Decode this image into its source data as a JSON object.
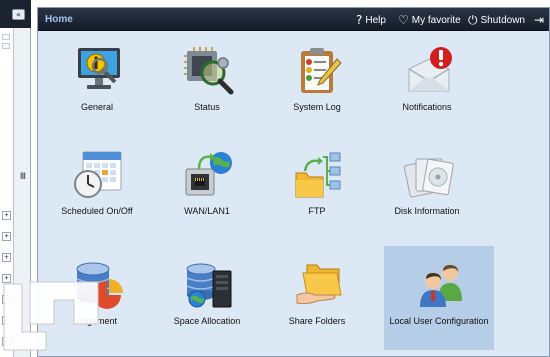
{
  "header": {
    "title": "Home",
    "help_label": "Help",
    "favorite_label": "My favorite",
    "shutdown_label": "Shutdown"
  },
  "sidebar": {
    "collapse_glyph": "«",
    "splitter_glyph": "Ⅲ"
  },
  "tiles": [
    {
      "label": "General",
      "icon": "monitor-info-icon"
    },
    {
      "label": "Status",
      "icon": "chip-magnifier-icon"
    },
    {
      "label": "System Log",
      "icon": "clipboard-log-icon"
    },
    {
      "label": "Notifications",
      "icon": "envelope-alert-icon"
    },
    {
      "label": "Scheduled On/Off",
      "icon": "calendar-clock-icon"
    },
    {
      "label": "WAN/LAN1",
      "icon": "network-port-globe-icon"
    },
    {
      "label": "FTP",
      "icon": "folder-transfer-icon"
    },
    {
      "label": "Disk Information",
      "icon": "disks-icon"
    },
    {
      "label": "nagement",
      "icon": "database-pie-icon"
    },
    {
      "label": "Space Allocation",
      "icon": "database-server-icon"
    },
    {
      "label": "Share Folders",
      "icon": "hand-folder-icon"
    },
    {
      "label": "Local User Configuration",
      "icon": "users-icon"
    }
  ],
  "colors": {
    "header_bg": "#161d29",
    "content_bg": "#dde8f5",
    "selected_tile": "#b5cde6",
    "title_text": "#9fc6f0"
  }
}
